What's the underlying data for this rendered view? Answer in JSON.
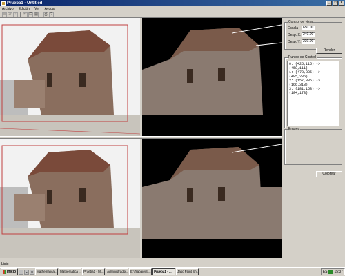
{
  "window": {
    "title": "Prueba1 - Untitled"
  },
  "menu": [
    "Archivo",
    "Edición",
    "Ver",
    "Ayuda"
  ],
  "toolbar_icons": [
    "new-file-icon",
    "open-folder-icon",
    "save-icon",
    "cut-icon",
    "copy-icon",
    "paste-icon",
    "print-icon",
    "help-icon"
  ],
  "control_vista": {
    "title": "Control de vista",
    "escala": {
      "label": "Escala",
      "value": "650.00"
    },
    "desp_x": {
      "label": "Desp. X:",
      "value": "240.00"
    },
    "desp_y": {
      "label": "Desp. Y:",
      "value": "230.00"
    },
    "render_label": "Render"
  },
  "puntos_control": {
    "title": "Puntos de Control",
    "items": [
      "0: (425,115) -> (458,111)",
      "1: (473,385) -> (485,286)",
      "2: (157,335) -> (166,318)",
      "3: (181,158) -> (184,178)"
    ]
  },
  "errores": {
    "title": "Errores"
  },
  "colorear_label": "Colorear",
  "status": "Listo",
  "taskbar": {
    "start": "Inicio",
    "tasks": [
      {
        "label": "Mathematica ...",
        "active": false
      },
      {
        "label": "Mathematica ...",
        "active": false
      },
      {
        "label": "Prueba1 - Mi...",
        "active": false
      },
      {
        "label": "Administrador...",
        "active": false
      },
      {
        "label": "E:\\Trabajo\\Si...",
        "active": false
      },
      {
        "label": "Prueba1 - ...",
        "active": true
      },
      {
        "label": "Jasc Paint Sh...",
        "active": false
      }
    ],
    "tray_lang": "ES",
    "clock": "15:37"
  }
}
